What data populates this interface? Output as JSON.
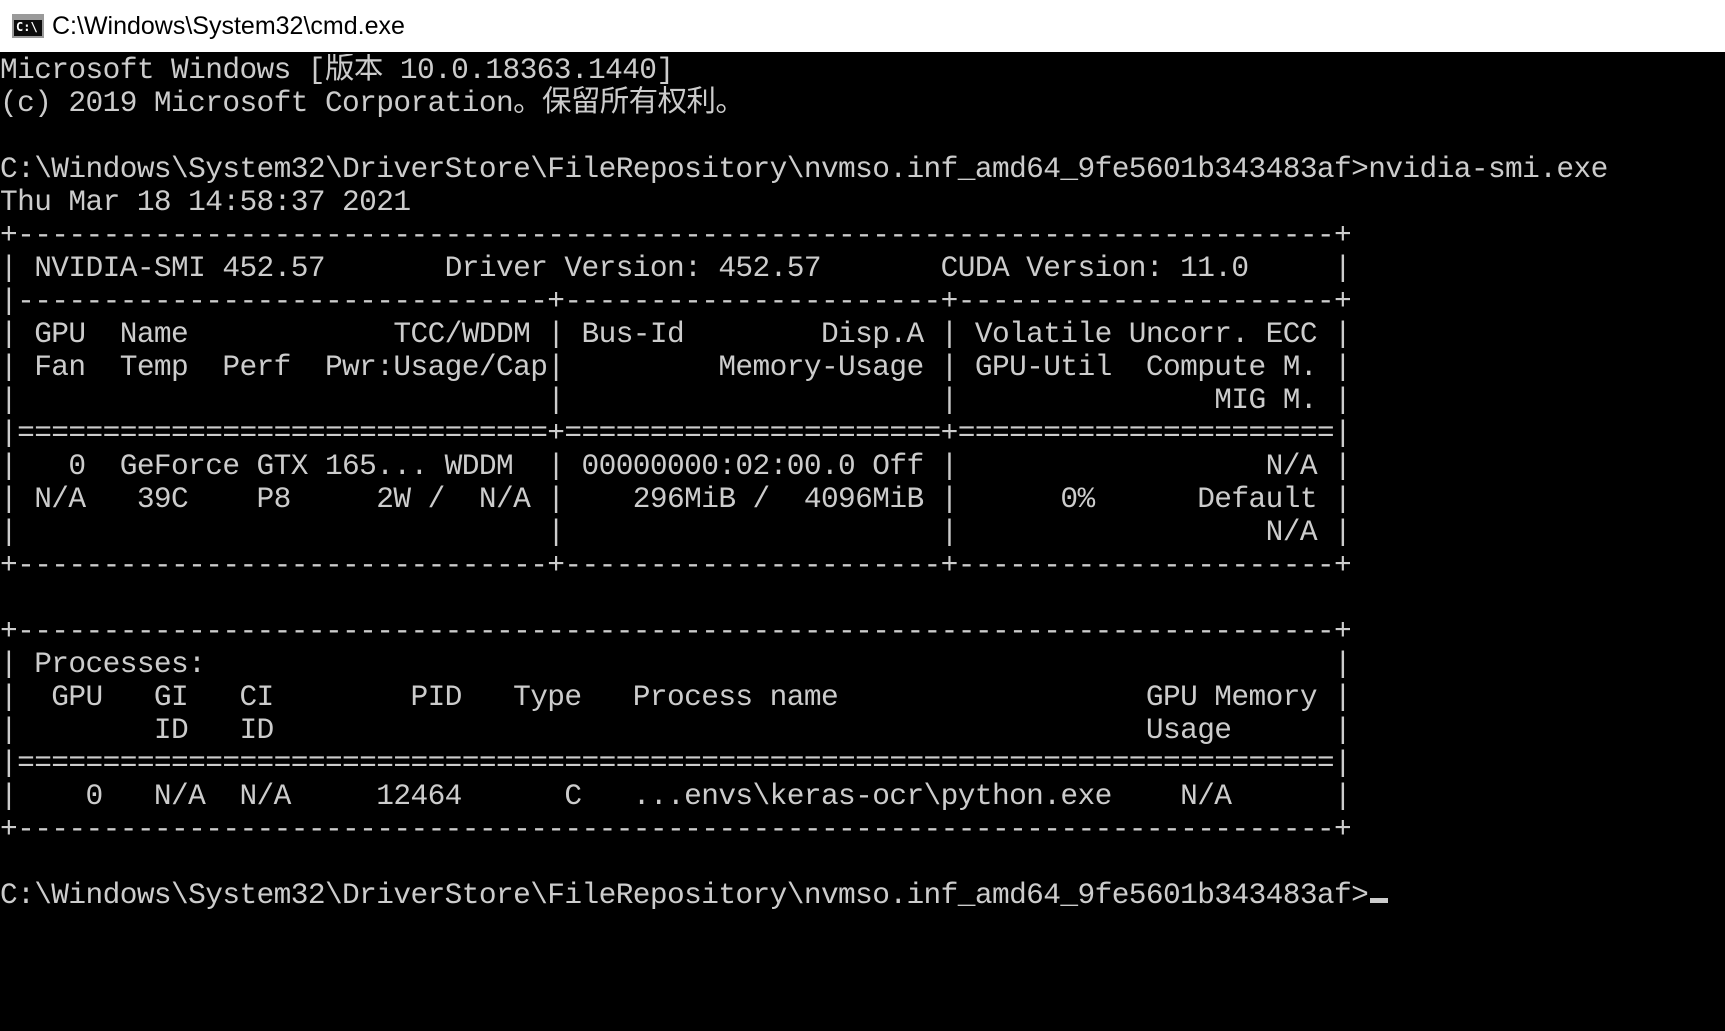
{
  "window": {
    "title": "C:\\Windows\\System32\\cmd.exe",
    "icon": "cmd-icon",
    "icon_glyph": "C:\\"
  },
  "console": {
    "lines": [
      "Microsoft Windows [版本 10.0.18363.1440]",
      "(c) 2019 Microsoft Corporation。保留所有权利。",
      "",
      "C:\\Windows\\System32\\DriverStore\\FileRepository\\nvmso.inf_amd64_9fe5601b343483af>nvidia-smi.exe",
      "Thu Mar 18 14:58:37 2021",
      "+-----------------------------------------------------------------------------+",
      "| NVIDIA-SMI 452.57       Driver Version: 452.57       CUDA Version: 11.0     |",
      "|-------------------------------+----------------------+----------------------+",
      "| GPU  Name            TCC/WDDM | Bus-Id        Disp.A | Volatile Uncorr. ECC |",
      "| Fan  Temp  Perf  Pwr:Usage/Cap|         Memory-Usage | GPU-Util  Compute M. |",
      "|                               |                      |               MIG M. |",
      "|===============================+======================+======================|",
      "|   0  GeForce GTX 165... WDDM  | 00000000:02:00.0 Off |                  N/A |",
      "| N/A   39C    P8     2W /  N/A |    296MiB /  4096MiB |      0%      Default |",
      "|                               |                      |                  N/A |",
      "+-------------------------------+----------------------+----------------------+",
      "",
      "+-----------------------------------------------------------------------------+",
      "| Processes:                                                                  |",
      "|  GPU   GI   CI        PID   Type   Process name                  GPU Memory |",
      "|        ID   ID                                                   Usage      |",
      "|=============================================================================|",
      "|    0   N/A  N/A     12464      C   ...envs\\keras-ocr\\python.exe    N/A      |",
      "+-----------------------------------------------------------------------------+",
      "",
      "C:\\Windows\\System32\\DriverStore\\FileRepository\\nvmso.inf_amd64_9fe5601b343483af>"
    ]
  },
  "colors": {
    "background": "#000000",
    "foreground": "#cccccc",
    "titlebar": "#ffffff"
  }
}
